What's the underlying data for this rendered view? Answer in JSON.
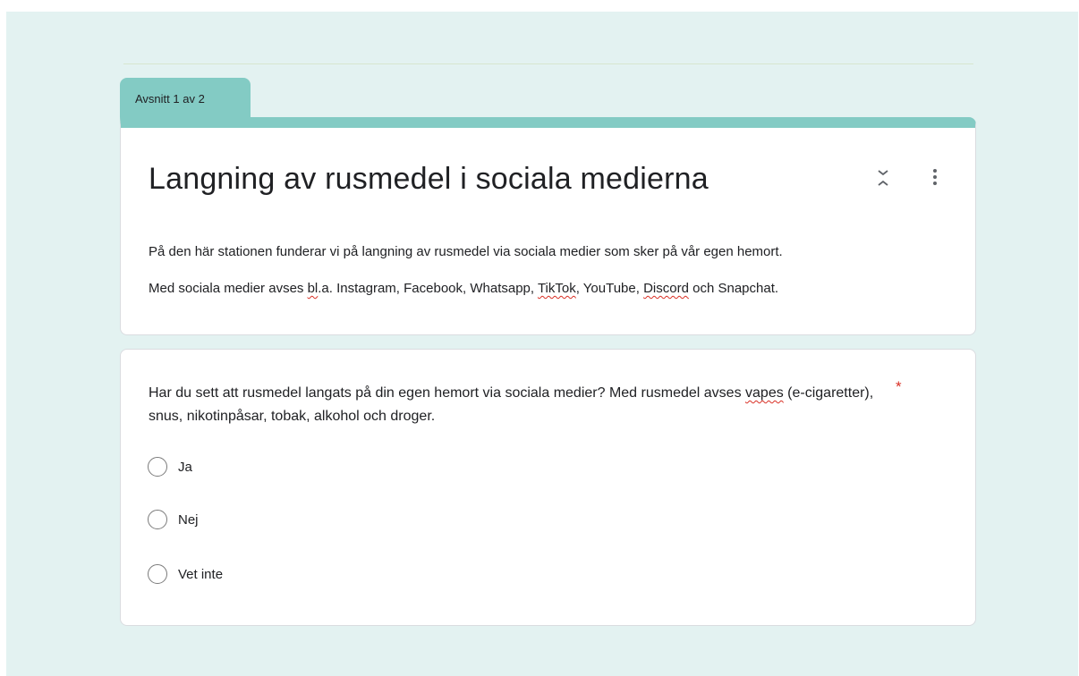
{
  "section": {
    "tab_label": "Avsnitt 1 av 2"
  },
  "header": {
    "title": "Langning av rusmedel i sociala medierna",
    "description_line1": "På den här stationen funderar vi på langning av rusmedel via sociala medier som sker på vår egen hemort.",
    "description_line2_a": "Med sociala medier avses ",
    "description_line2_b": "bl",
    "description_line2_c": ".a. Instagram, Facebook, Whatsapp, ",
    "description_line2_d": "TikTok",
    "description_line2_e": ", YouTube, ",
    "description_line2_f": "Discord",
    "description_line2_g": " och Snapchat.",
    "icons": {
      "collapse": "collapse-chevrons-icon",
      "more": "more-vert-icon"
    }
  },
  "question": {
    "text_a": "Har du sett att rusmedel langats på din egen hemort via sociala medier? Med rusmedel avses ",
    "text_b": "vapes",
    "text_c": " (e-cigaretter), snus, nikotinpåsar, tobak, alkohol och droger.",
    "required_mark": "*",
    "options": [
      "Ja",
      "Nej",
      "Vet inte"
    ]
  },
  "colors": {
    "accent": "#83cbc4",
    "background": "#e3f2f1",
    "required": "#d93025"
  }
}
